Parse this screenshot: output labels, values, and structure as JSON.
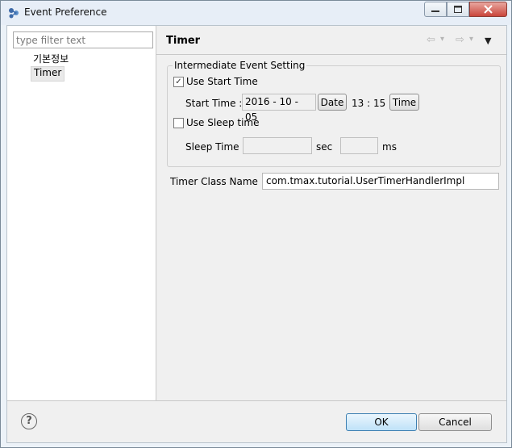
{
  "window": {
    "title": "Event Preference",
    "controls": {
      "minimize": "–",
      "maximize": "□",
      "close": "✕"
    }
  },
  "left": {
    "filter_placeholder": "type filter text",
    "tree": [
      {
        "label": "기본정보",
        "selected": false
      },
      {
        "label": "Timer",
        "selected": true
      }
    ]
  },
  "page": {
    "title": "Timer",
    "nav": {
      "back": "⇦",
      "forward": "⇨",
      "dropdown": "▾",
      "menu": "▼"
    }
  },
  "event_setting": {
    "legend": "Intermediate Event Setting",
    "use_start_time": {
      "label": "Use Start Time",
      "checked": true,
      "mark": "✓"
    },
    "start_time": {
      "label": "Start Time :",
      "date_value": "2016 - 10 - 05",
      "date_button": "Date",
      "time_value": "13 : 15",
      "time_button": "Time"
    },
    "use_sleep_time": {
      "label": "Use Sleep time",
      "checked": false,
      "mark": ""
    },
    "sleep_time": {
      "label": "Sleep Time :",
      "sec_value": "",
      "sec_unit": "sec",
      "ms_value": "",
      "ms_unit": "ms"
    }
  },
  "timer_class": {
    "label": "Timer Class Name :",
    "value": "com.tmax.tutorial.UserTimerHandlerImpl"
  },
  "footer": {
    "help": "?",
    "ok": "OK",
    "cancel": "Cancel"
  },
  "colors": {
    "title_bar": "#e7eef7",
    "dialog_bg": "#f0f0f0",
    "ok_accent": "#3c7fb1",
    "close_button": "#c9463b"
  }
}
